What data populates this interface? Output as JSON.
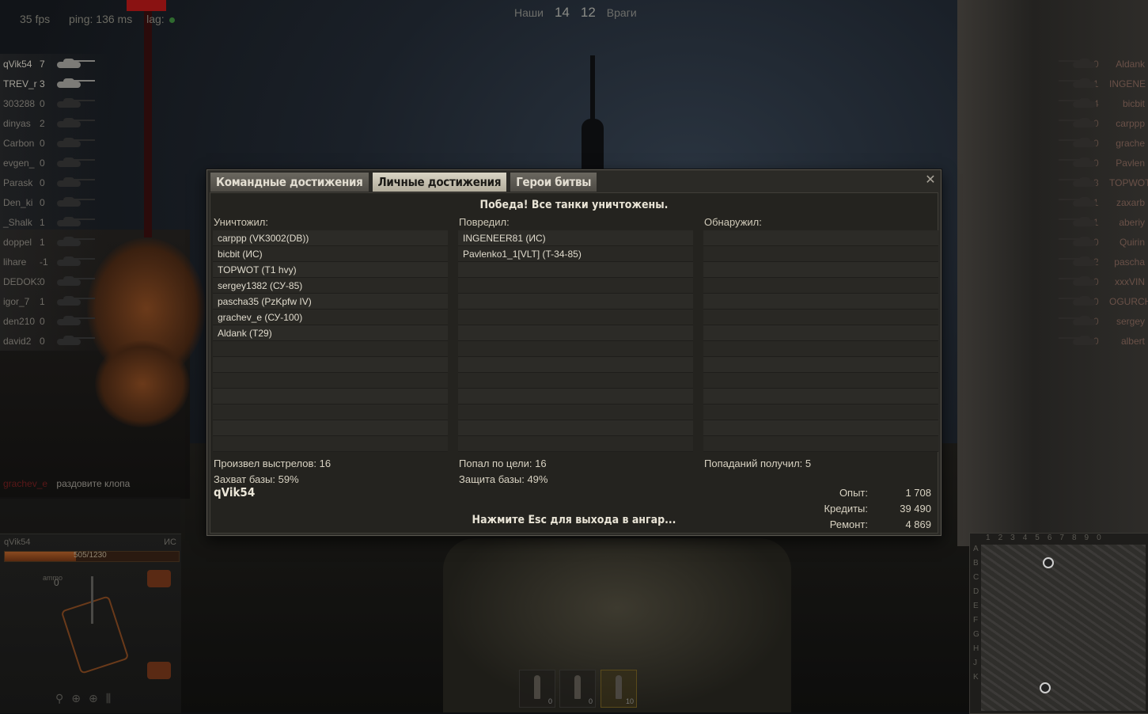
{
  "hud": {
    "fps": "35 fps",
    "ping": "ping: 136 ms",
    "lag": "lag:",
    "team_label": "Наши",
    "team_count": "14",
    "enemy_count": "12",
    "enemy_label": "Враги"
  },
  "allies": [
    {
      "name": "qVik54",
      "frags": "7",
      "alive": true
    },
    {
      "name": "TREV_r",
      "frags": "3",
      "alive": true
    },
    {
      "name": "303288",
      "frags": "0",
      "alive": false
    },
    {
      "name": "dinyas",
      "frags": "2",
      "alive": false
    },
    {
      "name": "Carbon",
      "frags": "0",
      "alive": false
    },
    {
      "name": "evgen_",
      "frags": "0",
      "alive": false
    },
    {
      "name": "Parask",
      "frags": "0",
      "alive": false
    },
    {
      "name": "Den_ki",
      "frags": "0",
      "alive": false
    },
    {
      "name": "_Shalk",
      "frags": "1",
      "alive": false
    },
    {
      "name": "doppel",
      "frags": "1",
      "alive": false
    },
    {
      "name": "lihare",
      "frags": "-1",
      "alive": false
    },
    {
      "name": "DEDOK3",
      "frags": "0",
      "alive": false
    },
    {
      "name": "igor_7",
      "frags": "1",
      "alive": false
    },
    {
      "name": "den210",
      "frags": "0",
      "alive": false
    },
    {
      "name": "david2",
      "frags": "0",
      "alive": false
    }
  ],
  "enemies": [
    {
      "name": "Aldank",
      "frags": "0"
    },
    {
      "name": "INGENE",
      "frags": "1"
    },
    {
      "name": "bicbit",
      "frags": "4"
    },
    {
      "name": "carppp",
      "frags": "0"
    },
    {
      "name": "grache",
      "frags": "0"
    },
    {
      "name": "Pavlen",
      "frags": "0"
    },
    {
      "name": "TOPWOT",
      "frags": "3"
    },
    {
      "name": "zaxarb",
      "frags": "1"
    },
    {
      "name": "aberiy",
      "frags": "1"
    },
    {
      "name": "Quirin",
      "frags": "0"
    },
    {
      "name": "pascha",
      "frags": "2"
    },
    {
      "name": "xxxVIN",
      "frags": "0"
    },
    {
      "name": "OGURCH",
      "frags": "0"
    },
    {
      "name": "sergey",
      "frags": "0"
    },
    {
      "name": "albert",
      "frags": "0"
    }
  ],
  "chat": {
    "sender": "grachev_e",
    "message": "раздовите клопа"
  },
  "player_panel": {
    "name": "qVik54",
    "tank": "ИС",
    "hp_text": "505/1230",
    "hp_fraction": 0.41,
    "ammo_count": "0",
    "ammo_label": "ammo"
  },
  "ammo_slots": [
    {
      "count": "0",
      "selected": false
    },
    {
      "count": "0",
      "selected": false
    },
    {
      "count": "10",
      "selected": true
    }
  ],
  "minimap": {
    "columns": [
      "1",
      "2",
      "3",
      "4",
      "5",
      "6",
      "7",
      "8",
      "9",
      "0"
    ],
    "rows": [
      "A",
      "B",
      "C",
      "D",
      "E",
      "F",
      "G",
      "H",
      "J",
      "K"
    ]
  },
  "dialog": {
    "tabs": [
      {
        "label": "Командные достижения",
        "active": false
      },
      {
        "label": "Личные достижения",
        "active": true
      },
      {
        "label": "Герои битвы",
        "active": false
      }
    ],
    "close_symbol": "✕",
    "result": "Победа! Все танки уничтожены.",
    "destroyed_header": "Уничтожил:",
    "damaged_header": "Повредил:",
    "spotted_header": "Обнаружил:",
    "destroyed": [
      "carppp (VK3002(DB))",
      "bicbit (ИС)",
      "TOPWOT (T1 hvy)",
      "sergey1382 (СУ-85)",
      "pascha35 (PzKpfw IV)",
      "grachev_e (СУ-100)",
      "Aldank (T29)"
    ],
    "damaged": [
      "INGENEER81 (ИС)",
      "Pavlenko1_1[VLT] (T-34-85)"
    ],
    "spotted": [],
    "stats": {
      "shots": "Произвел выстрелов: 16",
      "hits": "Попал по цели: 16",
      "received": "Попаданий получил: 5",
      "capture": "Захват базы: 59%",
      "defense": "Защита базы: 49%"
    },
    "player_name": "qVik54",
    "esc_hint": "Нажмите Esc для выхода в ангар...",
    "rewards": [
      {
        "label": "Опыт:",
        "value": "1 708"
      },
      {
        "label": "Кредиты:",
        "value": "39 490"
      },
      {
        "label": "Ремонт:",
        "value": "4 869"
      }
    ]
  }
}
